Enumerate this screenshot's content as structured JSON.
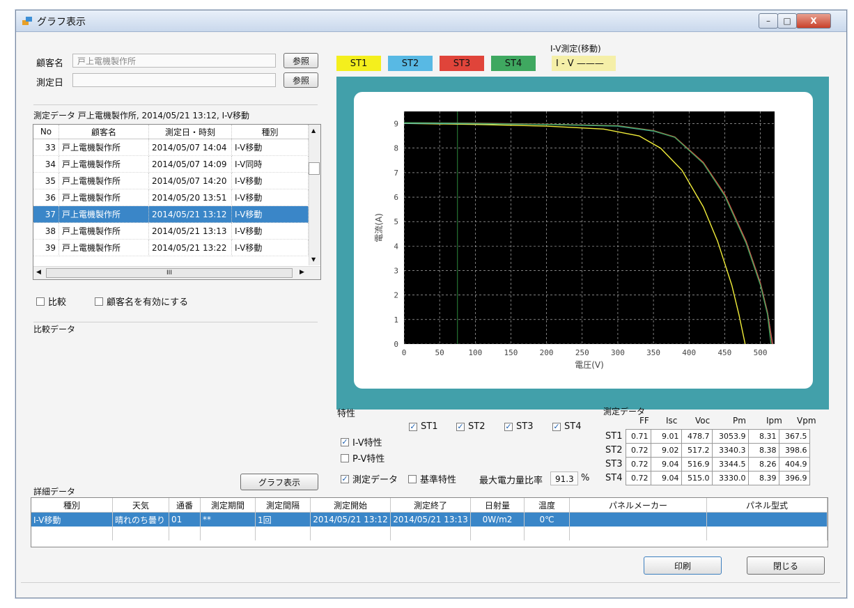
{
  "window": {
    "title": "グラフ表示",
    "min_label": "–",
    "max_label": "□",
    "close_label": "X"
  },
  "customer": {
    "label": "顧客名",
    "value": "戸上電機製作所",
    "ref_button": "参照"
  },
  "date": {
    "label": "測定日",
    "value": "",
    "ref_button": "参照"
  },
  "measure_data": {
    "header": "測定データ  戸上電機製作所, 2014/05/21 13:12, I-V移動"
  },
  "list": {
    "columns": [
      "No",
      "顧客名",
      "測定日・時刻",
      "種別"
    ],
    "rows": [
      {
        "no": "33",
        "name": "戸上電機製作所",
        "datetime": "2014/05/07 14:04",
        "type": "I-V移動"
      },
      {
        "no": "34",
        "name": "戸上電機製作所",
        "datetime": "2014/05/07 14:09",
        "type": "I-V同時"
      },
      {
        "no": "35",
        "name": "戸上電機製作所",
        "datetime": "2014/05/07 14:20",
        "type": "I-V移動"
      },
      {
        "no": "36",
        "name": "戸上電機製作所",
        "datetime": "2014/05/20 13:51",
        "type": "I-V移動"
      },
      {
        "no": "37",
        "name": "戸上電機製作所",
        "datetime": "2014/05/21 13:12",
        "type": "I-V移動"
      },
      {
        "no": "38",
        "name": "戸上電機製作所",
        "datetime": "2014/05/21 13:13",
        "type": "I-V移動"
      },
      {
        "no": "39",
        "name": "戸上電機製作所",
        "datetime": "2014/05/21 13:22",
        "type": "I-V移動"
      }
    ],
    "selected_index": 4,
    "hscroll_thumb": "III"
  },
  "options": {
    "compare": "比較",
    "enable_customer": "顧客名を有効にする"
  },
  "compare_data": {
    "label": "比較データ"
  },
  "detail": {
    "label": "詳細データ",
    "graph_button": "グラフ表示",
    "columns": [
      "種別",
      "天気",
      "通番",
      "測定期間",
      "測定間隔",
      "測定開始",
      "測定終了",
      "日射量",
      "温度",
      "パネルメーカー",
      "パネル型式"
    ],
    "row": [
      "I-V移動",
      "晴れのち曇り",
      "01",
      "**",
      "1回",
      "2014/05/21 13:12",
      "2014/05/21 13:13",
      "0W/m2",
      "0℃",
      "",
      ""
    ]
  },
  "legend": {
    "mode_label": "I-V測定(移動)",
    "iv_label": "I - V ———",
    "items": [
      {
        "name": "ST1",
        "color": "#f4ef1d"
      },
      {
        "name": "ST2",
        "color": "#58b9e4"
      },
      {
        "name": "ST3",
        "color": "#e0443a"
      },
      {
        "name": "ST4",
        "color": "#3fa860"
      }
    ]
  },
  "chart_data": {
    "type": "line",
    "title": "",
    "xlabel": "電圧(V)",
    "ylabel": "電流(A)",
    "xlim": [
      0,
      520
    ],
    "ylim": [
      0,
      9.5
    ],
    "xticks": [
      0,
      50,
      100,
      150,
      200,
      250,
      300,
      350,
      400,
      450,
      500
    ],
    "yticks": [
      0,
      1,
      2,
      3,
      4,
      5,
      6,
      7,
      8,
      9
    ],
    "grid": true,
    "background": "#000000",
    "series": [
      {
        "name": "ST1",
        "color": "#f2ee3a",
        "x": [
          0,
          100,
          200,
          280,
          330,
          360,
          390,
          420,
          440,
          460,
          470,
          478.7
        ],
        "y": [
          9.01,
          8.97,
          8.9,
          8.78,
          8.5,
          8.0,
          7.1,
          5.6,
          4.2,
          2.4,
          1.2,
          0
        ]
      },
      {
        "name": "ST2",
        "color": "#58b9e4",
        "x": [
          0,
          100,
          200,
          300,
          350,
          380,
          420,
          450,
          480,
          500,
          510,
          517.2
        ],
        "y": [
          9.02,
          9.0,
          8.97,
          8.9,
          8.7,
          8.45,
          7.4,
          6.1,
          4.2,
          2.5,
          1.3,
          0
        ]
      },
      {
        "name": "ST3",
        "color": "#e0443a",
        "x": [
          0,
          100,
          200,
          300,
          350,
          380,
          420,
          450,
          480,
          500,
          510,
          516.9
        ],
        "y": [
          9.04,
          9.02,
          8.98,
          8.92,
          8.72,
          8.46,
          7.42,
          6.12,
          4.2,
          2.5,
          1.3,
          0
        ]
      },
      {
        "name": "ST4",
        "color": "#3fa860",
        "x": [
          0,
          100,
          200,
          300,
          350,
          380,
          420,
          450,
          480,
          500,
          510,
          515.0
        ],
        "y": [
          9.04,
          9.01,
          8.97,
          8.91,
          8.71,
          8.44,
          7.38,
          6.06,
          4.12,
          2.42,
          1.22,
          0
        ]
      }
    ]
  },
  "characteristics": {
    "label": "特性",
    "st_checks": [
      "ST1",
      "ST2",
      "ST3",
      "ST4"
    ],
    "iv": "I-V特性",
    "pv": "P-V特性",
    "measured": "測定データ",
    "reference": "基準特性",
    "max_power_label": "最大電力量比率",
    "max_power_value": "91.3",
    "max_power_unit": "%"
  },
  "measure_table": {
    "label": "測定データ",
    "columns": [
      "FF",
      "Isc",
      "Voc",
      "Pm",
      "Ipm",
      "Vpm"
    ],
    "rows": [
      {
        "name": "ST1",
        "values": [
          "0.71",
          "9.01",
          "478.7",
          "3053.9",
          "8.31",
          "367.5"
        ]
      },
      {
        "name": "ST2",
        "values": [
          "0.72",
          "9.02",
          "517.2",
          "3340.3",
          "8.38",
          "398.6"
        ]
      },
      {
        "name": "ST3",
        "values": [
          "0.72",
          "9.04",
          "516.9",
          "3344.5",
          "8.26",
          "404.9"
        ]
      },
      {
        "name": "ST4",
        "values": [
          "0.72",
          "9.04",
          "515.0",
          "3330.0",
          "8.39",
          "396.9"
        ]
      }
    ]
  },
  "footer": {
    "print": "印刷",
    "close": "閉じる"
  }
}
